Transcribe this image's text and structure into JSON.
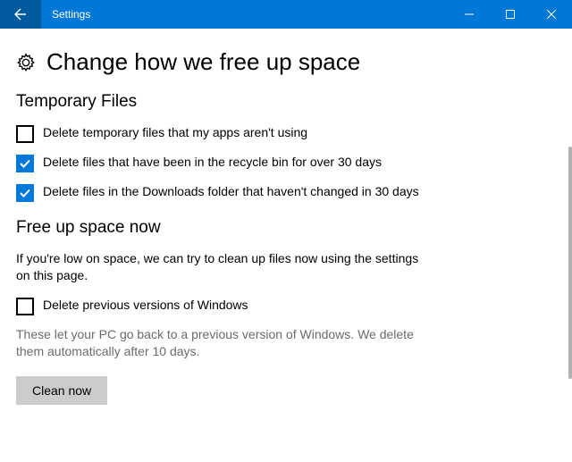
{
  "window": {
    "title": "Settings"
  },
  "page": {
    "title": "Change how we free up space"
  },
  "temporary_files": {
    "heading": "Temporary Files",
    "items": [
      {
        "label": "Delete temporary files that my apps aren't using",
        "checked": false
      },
      {
        "label": "Delete files that have been in the recycle bin for over 30 days",
        "checked": true
      },
      {
        "label": "Delete files in the Downloads folder that haven't changed in 30 days",
        "checked": true
      }
    ]
  },
  "free_up_now": {
    "heading": "Free up space now",
    "description": "If you're low on space, we can try to clean up files now using the settings on this page.",
    "checkbox": {
      "label": "Delete previous versions of Windows",
      "checked": false
    },
    "help": "These let your PC go back to a previous version of Windows. We delete them automatically after 10 days.",
    "button_label": "Clean now"
  }
}
